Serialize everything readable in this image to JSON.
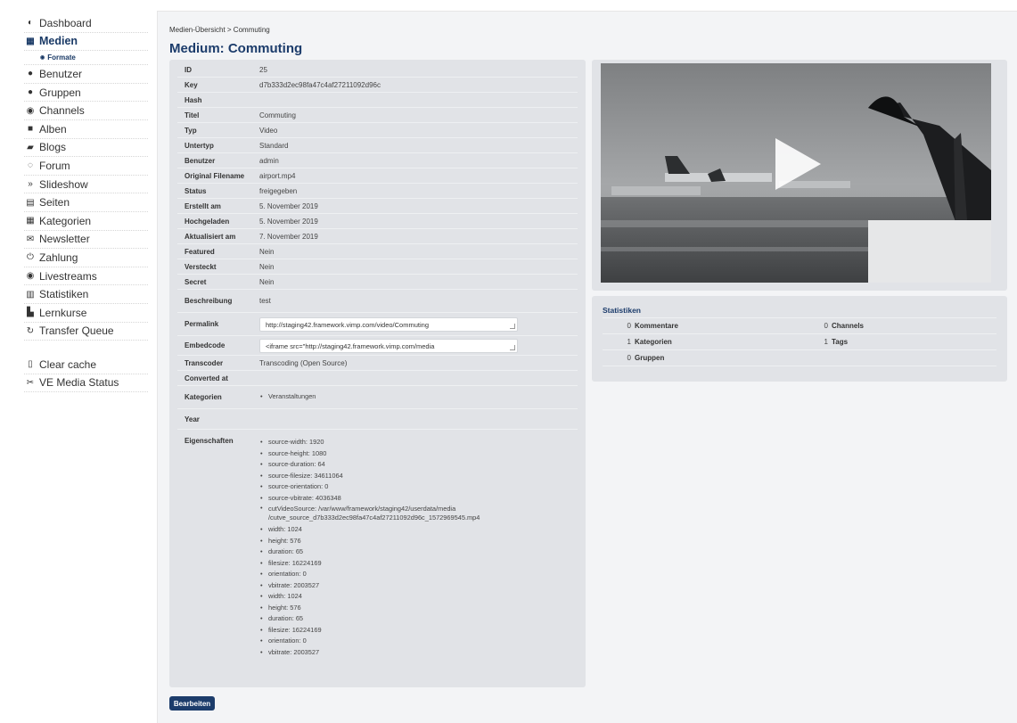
{
  "sidebar": {
    "items": [
      {
        "label": "Dashboard",
        "icon": "dashboard-icon",
        "glyph": "◐"
      },
      {
        "label": "Medien",
        "icon": "film-icon",
        "glyph": "▦"
      },
      {
        "label": "Benutzer",
        "icon": "user-icon",
        "glyph": "●"
      },
      {
        "label": "Gruppen",
        "icon": "users-icon",
        "glyph": "●"
      },
      {
        "label": "Channels",
        "icon": "channel-icon",
        "glyph": "◉"
      },
      {
        "label": "Alben",
        "icon": "camera-icon",
        "glyph": "■"
      },
      {
        "label": "Blogs",
        "icon": "book-icon",
        "glyph": "▰"
      },
      {
        "label": "Forum",
        "icon": "chat-icon",
        "glyph": "◌"
      },
      {
        "label": "Slideshow",
        "icon": "slideshow-icon",
        "glyph": "»"
      },
      {
        "label": "Seiten",
        "icon": "page-icon",
        "glyph": "▤"
      },
      {
        "label": "Kategorien",
        "icon": "grid-icon",
        "glyph": "▦"
      },
      {
        "label": "Newsletter",
        "icon": "mail-icon",
        "glyph": "✉"
      },
      {
        "label": "Zahlung",
        "icon": "power-icon",
        "glyph": "⏻"
      },
      {
        "label": "Livestreams",
        "icon": "livestream-icon",
        "glyph": "◉"
      },
      {
        "label": "Statistiken",
        "icon": "chart-icon",
        "glyph": "▥"
      },
      {
        "label": "Lernkurse",
        "icon": "course-icon",
        "glyph": "▙"
      },
      {
        "label": "Transfer Queue",
        "icon": "refresh-icon",
        "glyph": "↻"
      },
      {
        "label": "Clear cache",
        "icon": "trash-icon",
        "glyph": "▯"
      },
      {
        "label": "VE Media Status",
        "icon": "scissors-icon",
        "glyph": "✂"
      }
    ],
    "sub_formate": "Formate",
    "sub_icon": "eye-icon",
    "sub_glyph": "◉"
  },
  "breadcrumb": "Medien-Übersicht > Commuting",
  "title": "Medium: Commuting",
  "details": {
    "id": {
      "label": "ID",
      "value": "25"
    },
    "key": {
      "label": "Key",
      "value": "d7b333d2ec98fa47c4af27211092d96c"
    },
    "hash": {
      "label": "Hash",
      "value": ""
    },
    "titel": {
      "label": "Titel",
      "value": "Commuting"
    },
    "typ": {
      "label": "Typ",
      "value": "Video"
    },
    "untertyp": {
      "label": "Untertyp",
      "value": "Standard"
    },
    "benutzer": {
      "label": "Benutzer",
      "value": "admin"
    },
    "original_filename": {
      "label": "Original Filename",
      "value": "airport.mp4"
    },
    "status": {
      "label": "Status",
      "value": "freigegeben"
    },
    "erstellt": {
      "label": "Erstellt am",
      "value": "5. November 2019"
    },
    "hochgeladen": {
      "label": "Hochgeladen",
      "value": "5. November 2019"
    },
    "aktualisiert": {
      "label": "Aktualisiert am",
      "value": "7. November 2019"
    },
    "featured": {
      "label": "Featured",
      "value": "Nein"
    },
    "versteckt": {
      "label": "Versteckt",
      "value": "Nein"
    },
    "secret": {
      "label": "Secret",
      "value": "Nein"
    },
    "beschreibung": {
      "label": "Beschreibung",
      "value": "test"
    },
    "permalink": {
      "label": "Permalink",
      "value": "http://staging42.framework.vimp.com/video/Commuting"
    },
    "embedcode": {
      "label": "Embedcode",
      "value": "<iframe src=\"http://staging42.framework.vimp.com/media"
    },
    "transcoder": {
      "label": "Transcoder",
      "value": "Transcoding (Open Source)"
    },
    "converted_at": {
      "label": "Converted at",
      "value": ""
    },
    "kategorien": {
      "label": "Kategorien",
      "value": "Veranstaltungen"
    },
    "year": {
      "label": "Year",
      "value": ""
    },
    "eigenschaften": {
      "label": "Eigenschaften",
      "items": [
        "source-width: 1920",
        "source-height: 1080",
        "source-duration: 64",
        "source-filesize: 34611064",
        "source-orientation: 0",
        "source-vbitrate: 4036348",
        "cutVideoSource: /var/www/framework/staging42/userdata/media",
        "width: 1024",
        "height: 576",
        "duration: 65",
        "filesize: 16224169",
        "orientation: 0",
        "vbitrate: 2003527",
        "width: 1024",
        "height: 576",
        "duration: 65",
        "filesize: 16224169",
        "orientation: 0",
        "vbitrate: 2003527"
      ],
      "cut_continuation": "/cutve_source_d7b333d2ec98fa47c4af27211092d96c_1572969545.mp4"
    }
  },
  "stats": {
    "title": "Statistiken",
    "rows": [
      [
        {
          "n": "0",
          "label": "Kommentare"
        },
        {
          "n": "0",
          "label": "Channels"
        }
      ],
      [
        {
          "n": "1",
          "label": "Kategorien"
        },
        {
          "n": "1",
          "label": "Tags"
        }
      ],
      [
        {
          "n": "0",
          "label": "Gruppen"
        },
        {
          "n": "",
          "label": ""
        }
      ]
    ]
  },
  "edit_button": "Bearbeiten",
  "colors": {
    "accent": "#1c3c6b",
    "panel": "#e1e3e7",
    "background": "#f3f4f6"
  }
}
